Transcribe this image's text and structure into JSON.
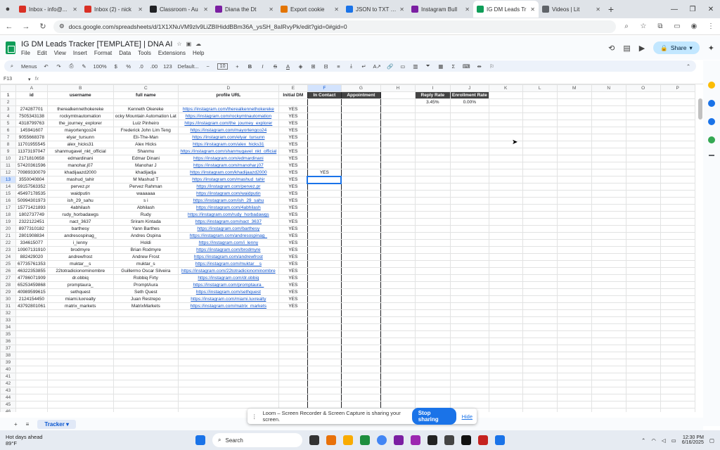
{
  "browser": {
    "tabs": [
      {
        "title": "Inbox - info@...",
        "color": "#d93025"
      },
      {
        "title": "Inbox (2) - nick",
        "color": "#d93025"
      },
      {
        "title": "Classroom - Au",
        "color": "#202124"
      },
      {
        "title": "Diana the Dt",
        "color": "#7b1fa2"
      },
      {
        "title": "Export cookie",
        "color": "#e37400"
      },
      {
        "title": "JSON to TXT Co",
        "color": "#1a73e8"
      },
      {
        "title": "Instagram Bull",
        "color": "#7b1fa2"
      },
      {
        "title": "IG DM Leads Tr",
        "color": "#0f9d58",
        "active": true
      },
      {
        "title": "Videos | Lit",
        "color": "#5f6368"
      }
    ],
    "url": "docs.google.com/spreadsheets/d/1X1XNuVM9zlv9LiZBIHiddBBm36A_ysSH_8aIRvyPk/edit?gid=0#gid=0"
  },
  "doc": {
    "title": "IG DM Leads Tracker [TEMPLATE] | DNA AI",
    "menus": [
      "File",
      "Edit",
      "View",
      "Insert",
      "Format",
      "Data",
      "Tools",
      "Extensions",
      "Help"
    ],
    "share_label": "Share"
  },
  "toolbar": {
    "menus_label": "Menus",
    "zoom": "100%",
    "font": "Default...",
    "font_size": "10"
  },
  "formula_bar": {
    "cell_ref": "F13",
    "formula": ""
  },
  "columns": [
    "A",
    "B",
    "C",
    "D",
    "E",
    "F",
    "G",
    "H",
    "I",
    "J",
    "K",
    "L",
    "M",
    "N",
    "O",
    "P"
  ],
  "header_row": [
    "id",
    "username",
    "full name",
    "profile URL",
    "Initial DM",
    "In Contact",
    "Appointment",
    "",
    "Reply Rate",
    "Enrollment Rate",
    "",
    "",
    "",
    "",
    "",
    ""
  ],
  "rates_row": [
    "",
    "",
    "",
    "",
    "",
    "",
    "",
    "",
    "3.45%",
    "0.00%",
    "",
    "",
    "",
    "",
    "",
    ""
  ],
  "leads": [
    {
      "id": "274287701",
      "username": "therealkennethokereke",
      "full_name": "Kenneth Okereke",
      "url": "https://instagram.com/therealkennethokereke",
      "dm": "YES",
      "contact": ""
    },
    {
      "id": "7505343138",
      "username": "rockymtnautomation",
      "full_name": "ocky Mountain Automation Lat",
      "url": "https://instagram.com/rockymtnautomation",
      "dm": "YES",
      "contact": ""
    },
    {
      "id": "4318799763",
      "username": "the_journey_explorer",
      "full_name": "Luiz Pinheiro",
      "url": "https://instagram.com/the_journey_explorer",
      "dm": "YES",
      "contact": ""
    },
    {
      "id": "145941607",
      "username": "mayortengco24",
      "full_name": "Frederick John Lim Teng",
      "url": "https://instagram.com/mayortengco24",
      "dm": "YES",
      "contact": ""
    },
    {
      "id": "9055668378",
      "username": "elyar_tursunn",
      "full_name": "Eli-The-Man",
      "url": "https://instagram.com/elyar_tursunn",
      "dm": "YES",
      "contact": ""
    },
    {
      "id": "11701955545",
      "username": "alex_hicks31",
      "full_name": "Alex Hicks",
      "url": "https://instagram.com/alex_hicks31",
      "dm": "YES",
      "contact": ""
    },
    {
      "id": "11373197047",
      "username": "shanmugavel_nkt_official",
      "full_name": "Shanmu",
      "url": "https://instagram.com/shanmugavel_nkt_official",
      "dm": "YES",
      "contact": ""
    },
    {
      "id": "2171810658",
      "username": "edmardinani",
      "full_name": "Edmar Dinani",
      "url": "https://instagram.com/edmardinani",
      "dm": "YES",
      "contact": ""
    },
    {
      "id": "57420361596",
      "username": "manohar.j07",
      "full_name": "Manohar J",
      "url": "https://instagram.com/manohar.j07",
      "dm": "YES",
      "contact": ""
    },
    {
      "id": "70989330079",
      "username": "khadijaazd2000",
      "full_name": "khadijadja",
      "url": "https://instagram.com/khadijaazd2000",
      "dm": "YES",
      "contact": "YES"
    },
    {
      "id": "3550040804",
      "username": "mashud_tahir",
      "full_name": "M Mashud T",
      "url": "https://instagram.com/mashud_tahir",
      "dm": "YES",
      "contact": ""
    },
    {
      "id": "59157563352",
      "username": "pervez.pr",
      "full_name": "Pervez Rahman",
      "url": "https://instagram.com/pervez.pr",
      "dm": "YES",
      "contact": ""
    },
    {
      "id": "45497178535",
      "username": "waidputin",
      "full_name": "waaaaaa",
      "url": "https://instagram.com/waidputin",
      "dm": "YES",
      "contact": ""
    },
    {
      "id": "50994301973",
      "username": "ish_29_sahu",
      "full_name": "s i",
      "url": "https://instagram.com/ish_29_sahu",
      "dm": "YES",
      "contact": ""
    },
    {
      "id": "15771421893",
      "username": "4abhilash",
      "full_name": "Abhilash",
      "url": "https://instagram.com/4abhilash",
      "dm": "YES",
      "contact": ""
    },
    {
      "id": "1802737749",
      "username": "rudy_horbadawgs",
      "full_name": "Rudy",
      "url": "https://instagram.com/rudy_horbadawgs",
      "dm": "YES",
      "contact": ""
    },
    {
      "id": "2322122451",
      "username": "nact_3637",
      "full_name": "Sriram Kintada",
      "url": "https://instagram.com/nact_3637",
      "dm": "YES",
      "contact": ""
    },
    {
      "id": "8977310182",
      "username": "barthesy",
      "full_name": "Yann Barthes",
      "url": "https://instagram.com/barthesy",
      "dm": "YES",
      "contact": ""
    },
    {
      "id": "2801908834",
      "username": "andresospinag_",
      "full_name": "Andres Ospina",
      "url": "https://instagram.com/andresospinag_",
      "dm": "YES",
      "contact": ""
    },
    {
      "id": "334615077",
      "username": "i_lenny",
      "full_name": "Holdi",
      "url": "https://instagram.com/i_lenny",
      "dm": "YES",
      "contact": ""
    },
    {
      "id": "10907131910",
      "username": "brodmyre",
      "full_name": "Brian Rodmyre",
      "url": "https://instagram.com/brodmyre",
      "dm": "YES",
      "contact": ""
    },
    {
      "id": "882429020",
      "username": "andrewfrost",
      "full_name": "Andrew Frost",
      "url": "https://instagram.com/andrewfrost",
      "dm": "YES",
      "contact": ""
    },
    {
      "id": "67735761353",
      "username": "muktar__s",
      "full_name": "muktar_s",
      "url": "https://instagram.com/muktar__s",
      "dm": "YES",
      "contact": ""
    },
    {
      "id": "46322353855",
      "username": "22totradicionominombre",
      "full_name": "Guillermo Oscar Silveira",
      "url": "https://instagram.com/22totradicionominombre",
      "dm": "YES",
      "contact": ""
    },
    {
      "id": "47786071909",
      "username": "dr.obbiq",
      "full_name": "Robbiq Firty",
      "url": "https://instagram.com/dr.obbiq",
      "dm": "YES",
      "contact": ""
    },
    {
      "id": "65253459868",
      "username": "promptaura_",
      "full_name": "PromptAura",
      "url": "https://instagram.com/promptaura_",
      "dm": "YES",
      "contact": ""
    },
    {
      "id": "40989599615",
      "username": "sethquest",
      "full_name": "Seth Quest",
      "url": "https://instagram.com/sethquest",
      "dm": "YES",
      "contact": ""
    },
    {
      "id": "2124154450",
      "username": "miami.luxrealty",
      "full_name": "Juan Restrepo",
      "url": "https://instagram.com/miami.luxrealty",
      "dm": "YES",
      "contact": ""
    },
    {
      "id": "43792801061",
      "username": "matrix_markets",
      "full_name": "MatrixMarkets",
      "url": "https://instagram.com/matrix_markets",
      "dm": "YES",
      "contact": ""
    }
  ],
  "empty_rows": [
    "32",
    "33",
    "34",
    "35",
    "36",
    "37",
    "38",
    "39",
    "40",
    "41",
    "42",
    "43",
    "44",
    "45",
    "46"
  ],
  "sheet_tab": "Tracker",
  "loom": {
    "message": "Loom – Screen Recorder & Screen Capture is sharing your screen.",
    "stop_label": "Stop sharing",
    "hide_label": "Hide"
  },
  "taskbar": {
    "weather_title": "Hot days ahead",
    "weather_temp": "89°F",
    "search_placeholder": "Search",
    "time": "12:30 PM",
    "date": "6/16/2025"
  }
}
